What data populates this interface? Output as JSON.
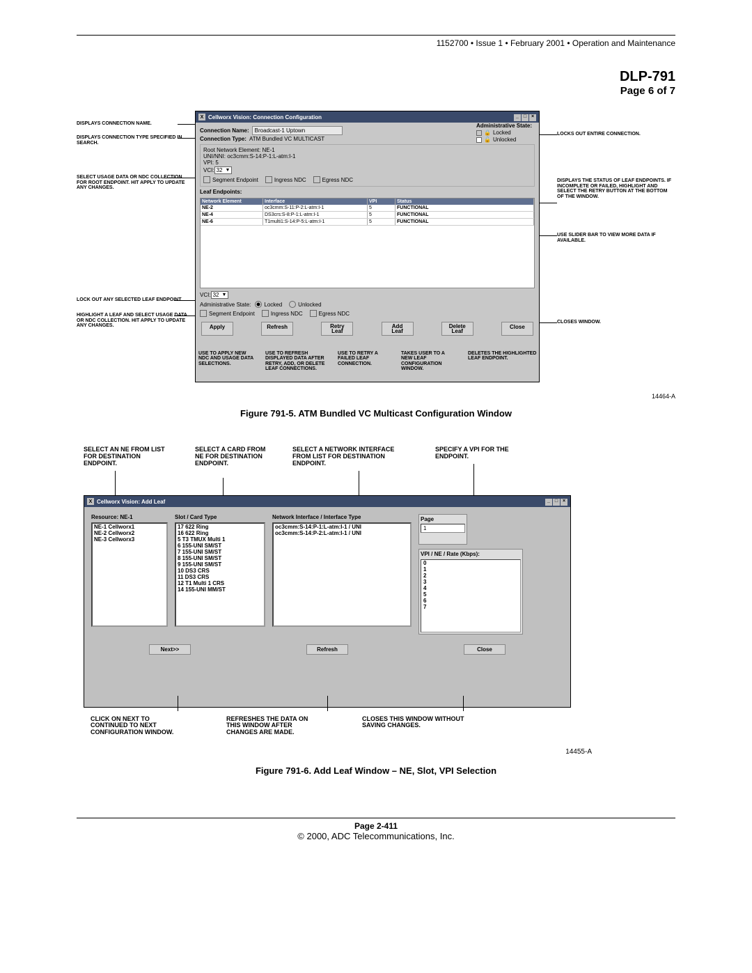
{
  "header": {
    "running": "1152700 • Issue 1 • February 2001 • Operation and Maintenance",
    "dlp": "DLP-791",
    "page_of": "Page 6 of 7"
  },
  "fig1": {
    "caption": "Figure 791-5. ATM Bundled VC Multicast Configuration Window",
    "fig_num": "14464-A",
    "window_title": "Cellworx Vision: Connection Configuration",
    "callouts": {
      "l1": "DISPLAYS CONNECTION NAME.",
      "l2": "DISPLAYS CONNECTION TYPE SPECIFIED IN SEARCH.",
      "l3": "SELECT USAGE DATA OR NDC COLLECTION FOR ROOT ENDPOINT. HIT APPLY TO UPDATE ANY CHANGES.",
      "l4": "LOCK OUT ANY SELECTED LEAF ENDPOINT.",
      "l5": "HIGHLIGHT A LEAF AND SELECT USAGE DATA OR NDC COLLECTION. HIT APPLY TO UPDATE ANY CHANGES.",
      "r1": "LOCKS OUT ENTIRE CONNECTION.",
      "r2": "DISPLAYS THE STATUS OF LEAF ENDPOINTS. IF INCOMPLETE OR FAILED, HIGHLIGHT AND SELECT THE RETRY BUTTON AT THE BOTTOM OF THE WINDOW.",
      "r3": "USE SLIDER BAR TO VIEW MORE DATA IF AVAILABLE.",
      "r4": "CLOSES WINDOW."
    },
    "fields": {
      "conn_name_lbl": "Connection Name:",
      "conn_name_val": "Broadcast-1 Uptown",
      "conn_type_lbl": "Connection Type:",
      "conn_type_val": "ATM Bundled VC MULTICAST",
      "admin_state_lbl": "Administrative State:",
      "locked_lbl": "Locked",
      "unlocked_lbl": "Unlocked",
      "root_ne": "Root Network Element:  NE-1",
      "uni_nni": "UNI/NNI:  oc3cmm:S-14:P-1:L-atm:I-1",
      "vpi": "VPI:  5",
      "vci_lbl": "VCI:",
      "vci_val": "32",
      "seg_ep": "Segment Endpoint",
      "ingress": "Ingress NDC",
      "egress": "Egress NDC",
      "leaf_ep_lbl": "Leaf Endpoints:",
      "admin_state2": "Administrative State:"
    },
    "table": {
      "head": [
        "Network Element",
        "Interface",
        "VPI",
        "Status"
      ],
      "rows": [
        [
          "NE-2",
          "oc3cmm:S-11:P-2:L-atm:I-1",
          "5",
          "FUNCTIONAL"
        ],
        [
          "NE-4",
          "DS3crs:S-8:P-1:L-atm:I-1",
          "5",
          "FUNCTIONAL"
        ],
        [
          "NE-6",
          "T1multi1:S-14:P-5:L-atm:I-1",
          "5",
          "FUNCTIONAL"
        ]
      ]
    },
    "buttons": {
      "apply": "Apply",
      "refresh": "Refresh",
      "retry": "Retry\nLeaf",
      "add": "Add\nLeaf",
      "delete": "Delete\nLeaf",
      "close": "Close"
    },
    "below": {
      "apply": "USE TO APPLY NEW NDC AND USAGE DATA SELECTIONS.",
      "refresh": "USE TO REFRESH DISPLAYED DATA AFTER RETRY, ADD, OR DELETE LEAF CONNECTIONS.",
      "retry": "USE TO RETRY A FAILED LEAF CONNECTION.",
      "add": "TAKES USER TO A NEW LEAF CONFIGURATION WINDOW.",
      "delete": "DELETES THE HIGHLIGHTED LEAF ENDPOINT."
    }
  },
  "fig2": {
    "caption": "Figure 791-6. Add Leaf Window – NE, Slot, VPI Selection",
    "fig_num": "14455-A",
    "window_title": "Cellworx Vision:  Add Leaf",
    "callouts": {
      "c1": "SELECT AN NE FROM LIST FOR DESTINATION ENDPOINT.",
      "c2": "SELECT A CARD FROM NE FOR DESTINATION ENDPOINT.",
      "c3": "SELECT A NETWORK INTERFACE FROM LIST FOR DESTINATION ENDPOINT.",
      "c4": "SPECIFY A VPI FOR THE ENDPOINT."
    },
    "cols": {
      "resource_lbl": "Resource:  NE-1",
      "slot_lbl": "Slot / Card Type",
      "net_lbl": "Network Interface / Interface Type",
      "page_lbl": "Page",
      "page_val": "1",
      "vpi_rate_lbl": "VPI / NE / Rate (Kbps):"
    },
    "resource_list": [
      "NE-1  Cellworx1",
      "NE-2  Cellworx2",
      "NE-3  Cellworx3"
    ],
    "slot_list": [
      "17  622 Ring",
      "16  622 Ring",
      "5   T3 TMUX Multi 1",
      "6   155-UNI SM/ST",
      "7   155-UNI SM/ST",
      "8   155-UNI SM/ST",
      "9   155-UNI SM/ST",
      "10  DS3 CRS",
      "11  DS3 CRS",
      "12  T1 Multi 1 CRS",
      "14  155-UNI MM/ST"
    ],
    "net_list": [
      "oc3cmm:S-14:P-1:L-atm:I-1 / UNI",
      "oc3cmm:S-14:P-2:L-atm:I-1 / UNI"
    ],
    "vpi_list": [
      "0",
      "1",
      "2",
      "3",
      "4",
      "5",
      "6",
      "7"
    ],
    "buttons": {
      "next": "Next>>",
      "refresh": "Refresh",
      "close": "Close"
    },
    "below": {
      "next": "CLICK ON NEXT TO CONTINUED TO NEXT CONFIGURATION WINDOW.",
      "refresh": "REFRESHES THE DATA ON THIS WINDOW AFTER CHANGES ARE MADE.",
      "close": "CLOSES THIS WINDOW WITHOUT SAVING CHANGES."
    }
  },
  "footer": {
    "page": "Page 2-411",
    "copyright": "© 2000, ADC Telecommunications, Inc."
  }
}
